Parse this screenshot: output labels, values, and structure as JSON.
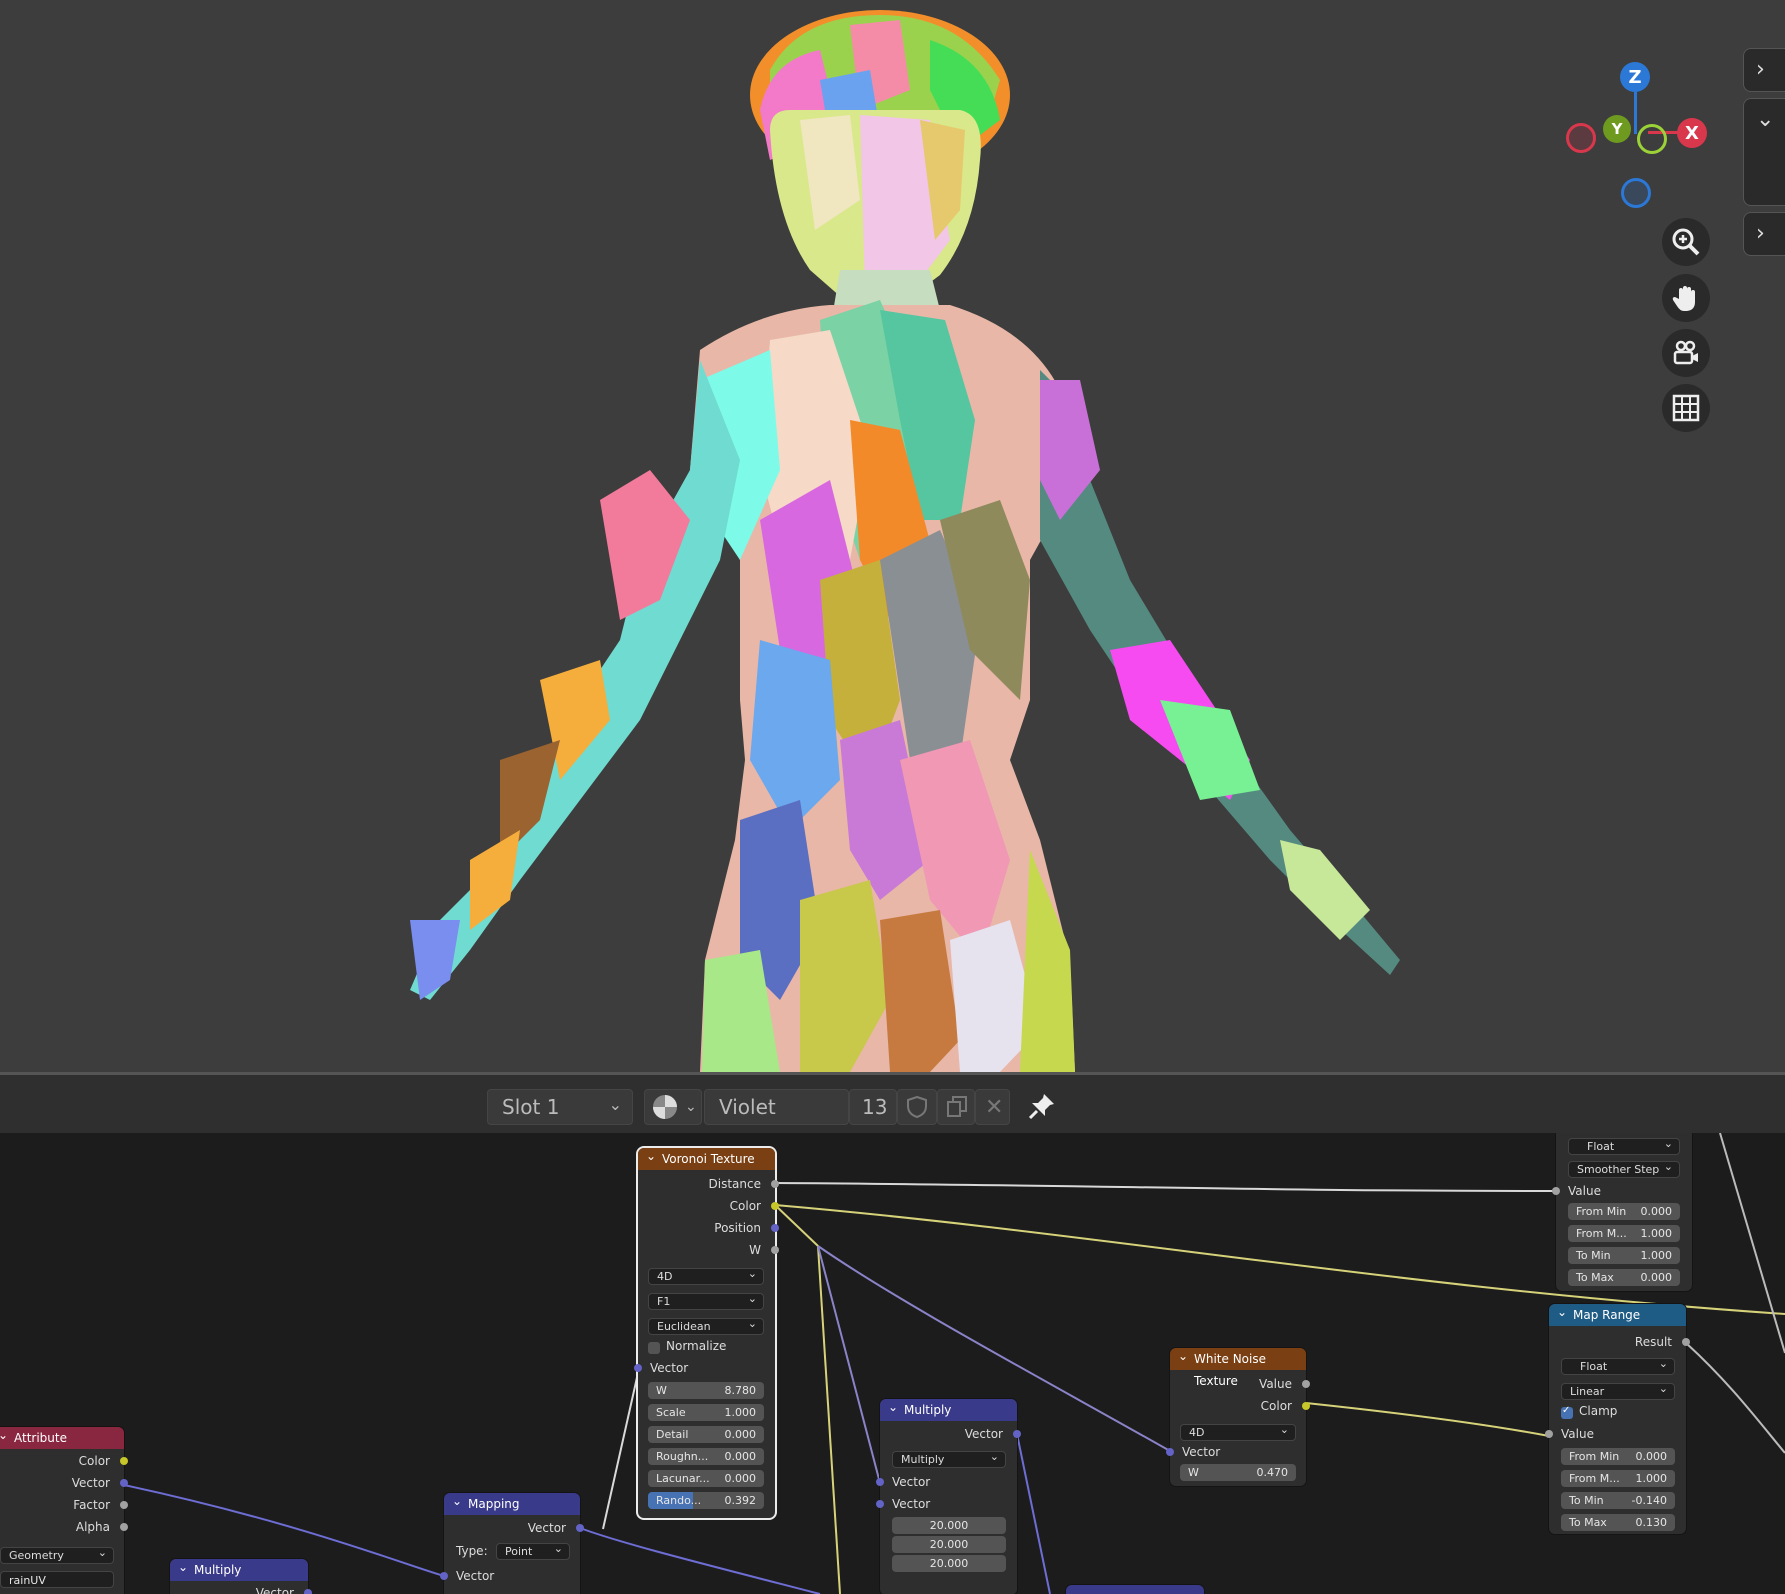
{
  "colors": {
    "viewport_bg": "#3d3d3d",
    "node_editor_bg": "#1c1c1c",
    "accent_blue": "#4772b3"
  },
  "gizmo": {
    "z": "Z",
    "y": "Y",
    "x": "X"
  },
  "viewport_tools": [
    "zoom-icon",
    "hand-pan-icon",
    "camera-icon",
    "grid-icon"
  ],
  "header": {
    "slot": "Slot 1",
    "material_name": "Violet",
    "user_count": "13"
  },
  "voronoi": {
    "title": "Voronoi Texture",
    "outputs": [
      "Distance",
      "Color",
      "Position",
      "W"
    ],
    "dimensions": "4D",
    "feature": "F1",
    "metric": "Euclidean",
    "normalize_label": "Normalize",
    "vector_label": "Vector",
    "params": [
      {
        "label": "W",
        "value": "8.780"
      },
      {
        "label": "Scale",
        "value": "1.000"
      },
      {
        "label": "Detail",
        "value": "0.000"
      },
      {
        "label": "Roughn...",
        "value": "0.000"
      },
      {
        "label": "Lacunar...",
        "value": "0.000"
      },
      {
        "label": "Rando...",
        "value": "0.392"
      }
    ]
  },
  "map_range_top": {
    "data_type": "Float",
    "interpolation": "Smoother Step",
    "value_label": "Value",
    "params": [
      {
        "label": "From Min",
        "value": "0.000"
      },
      {
        "label": "From M...",
        "value": "1.000"
      },
      {
        "label": "To Min",
        "value": "1.000"
      },
      {
        "label": "To Max",
        "value": "0.000"
      }
    ]
  },
  "map_range": {
    "title": "Map Range",
    "result_label": "Result",
    "data_type": "Float",
    "interpolation": "Linear",
    "clamp_label": "Clamp",
    "value_label": "Value",
    "params": [
      {
        "label": "From Min",
        "value": "0.000"
      },
      {
        "label": "From M...",
        "value": "1.000"
      },
      {
        "label": "To Min",
        "value": "-0.140"
      },
      {
        "label": "To Max",
        "value": "0.130"
      }
    ]
  },
  "white_noise": {
    "title": "White Noise Texture",
    "outputs": [
      "Value",
      "Color"
    ],
    "dimensions": "4D",
    "vector_label": "Vector",
    "w_label": "W",
    "w_value": "0.470"
  },
  "multiply_mid": {
    "title": "Multiply",
    "output": "Vector",
    "operation": "Multiply",
    "inputs": [
      "Vector",
      "Vector"
    ],
    "values": [
      "20.000",
      "20.000",
      "20.000"
    ]
  },
  "attribute": {
    "title": "Attribute",
    "outputs": [
      "Color",
      "Vector",
      "Factor",
      "Alpha"
    ],
    "type": "Geometry",
    "name": "rainUV"
  },
  "mapping": {
    "title": "Mapping",
    "output": "Vector",
    "type_label": "Type:",
    "type_value": "Point",
    "input": "Vector"
  },
  "multiply_low": {
    "title": "Multiply",
    "output": "Vector"
  }
}
